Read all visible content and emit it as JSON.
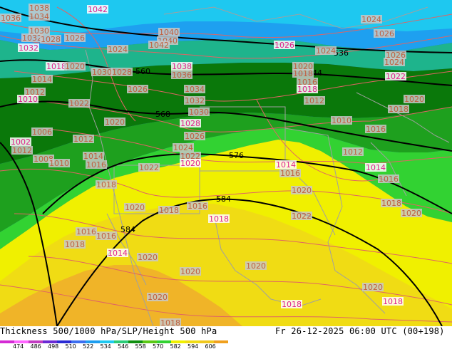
{
  "footer": {
    "title": "Thickness 500/1000 hPa/SLP/Height 500 hPa",
    "valid": "Fr 26-12-2025 06:00 UTC (00+198)"
  },
  "legend": {
    "swatches": [
      {
        "color": "#d42ad4"
      },
      {
        "color": "#ff66ff"
      },
      {
        "color": "#c23cc2"
      },
      {
        "color": "#6a2ad4"
      },
      {
        "color": "#2a2ad4"
      },
      {
        "color": "#3c6ef0"
      },
      {
        "color": "#1e9ef0"
      },
      {
        "color": "#1ec8f0"
      },
      {
        "color": "#2acc78"
      },
      {
        "color": "#0f8f0f"
      },
      {
        "color": "#5ac814"
      },
      {
        "color": "#32d232"
      },
      {
        "color": "#f0f000"
      },
      {
        "color": "#f0dc14"
      },
      {
        "color": "#f0c81e"
      },
      {
        "color": "#f0a01e"
      }
    ],
    "ticks": [
      "474",
      "486",
      "498",
      "510",
      "522",
      "534",
      "546",
      "558",
      "570",
      "582",
      "594",
      "606"
    ]
  },
  "map": {
    "colors": {
      "deep_blue": "#1e5ad2",
      "blue": "#1ea0f0",
      "cyan": "#1ec8f0",
      "teal": "#1eb48c",
      "dark_green": "#0a780a",
      "green": "#1ea01e",
      "lime": "#32d232",
      "yellow": "#f0f000",
      "gold": "#f0dc14",
      "orange": "#f0b428",
      "coast": "#a0a0a0",
      "isobar": "#e06464",
      "height": "#000000"
    },
    "height_labels": [
      {
        "text": "560"
      },
      {
        "text": "568"
      },
      {
        "text": "576"
      },
      {
        "text": "584"
      },
      {
        "text": "584"
      },
      {
        "text": "536"
      },
      {
        "text": "544"
      }
    ],
    "pressure_labels": [
      {
        "text": "1036"
      },
      {
        "text": "1038"
      },
      {
        "text": "1034"
      },
      {
        "text": "1042"
      },
      {
        "text": "1030"
      },
      {
        "text": "1032"
      },
      {
        "text": "1028"
      },
      {
        "text": "1026"
      },
      {
        "text": "1032"
      },
      {
        "text": "1024"
      },
      {
        "text": "1040"
      },
      {
        "text": "1040"
      },
      {
        "text": "1042"
      },
      {
        "text": "1018"
      },
      {
        "text": "1020"
      },
      {
        "text": "1030"
      },
      {
        "text": "1028"
      },
      {
        "text": "1014"
      },
      {
        "text": "1038"
      },
      {
        "text": "1036"
      },
      {
        "text": "1012"
      },
      {
        "text": "1026"
      },
      {
        "text": "1034"
      },
      {
        "text": "1010"
      },
      {
        "text": "1022"
      },
      {
        "text": "1032"
      },
      {
        "text": "1030"
      },
      {
        "text": "1006"
      },
      {
        "text": "1028"
      },
      {
        "text": "1020"
      },
      {
        "text": "1012"
      },
      {
        "text": "1012"
      },
      {
        "text": "1026"
      },
      {
        "text": "1002"
      },
      {
        "text": "1024"
      },
      {
        "text": "1022"
      },
      {
        "text": "1008"
      },
      {
        "text": "1014"
      },
      {
        "text": "1020"
      },
      {
        "text": "1010"
      },
      {
        "text": "1016"
      },
      {
        "text": "1022"
      },
      {
        "text": "1018"
      },
      {
        "text": "1014"
      },
      {
        "text": "1016"
      },
      {
        "text": "1020"
      },
      {
        "text": "1018"
      },
      {
        "text": "1016"
      },
      {
        "text": "1018"
      },
      {
        "text": "1016"
      },
      {
        "text": "1016"
      },
      {
        "text": "1018"
      },
      {
        "text": "1020"
      },
      {
        "text": "1014"
      },
      {
        "text": "1020"
      },
      {
        "text": "1022"
      },
      {
        "text": "1020"
      },
      {
        "text": "1020"
      },
      {
        "text": "1018"
      },
      {
        "text": "1020"
      },
      {
        "text": "1018"
      },
      {
        "text": "1024"
      },
      {
        "text": "1026"
      },
      {
        "text": "1026"
      },
      {
        "text": "1024"
      },
      {
        "text": "1020"
      },
      {
        "text": "1018"
      },
      {
        "text": "1016"
      },
      {
        "text": "1018"
      },
      {
        "text": "1012"
      },
      {
        "text": "1010"
      },
      {
        "text": "1024"
      },
      {
        "text": "1026"
      },
      {
        "text": "1022"
      },
      {
        "text": "1020"
      },
      {
        "text": "1018"
      },
      {
        "text": "1016"
      },
      {
        "text": "1012"
      },
      {
        "text": "1014"
      },
      {
        "text": "1016"
      },
      {
        "text": "1018"
      },
      {
        "text": "1020"
      },
      {
        "text": "1020"
      },
      {
        "text": "1018"
      }
    ]
  }
}
